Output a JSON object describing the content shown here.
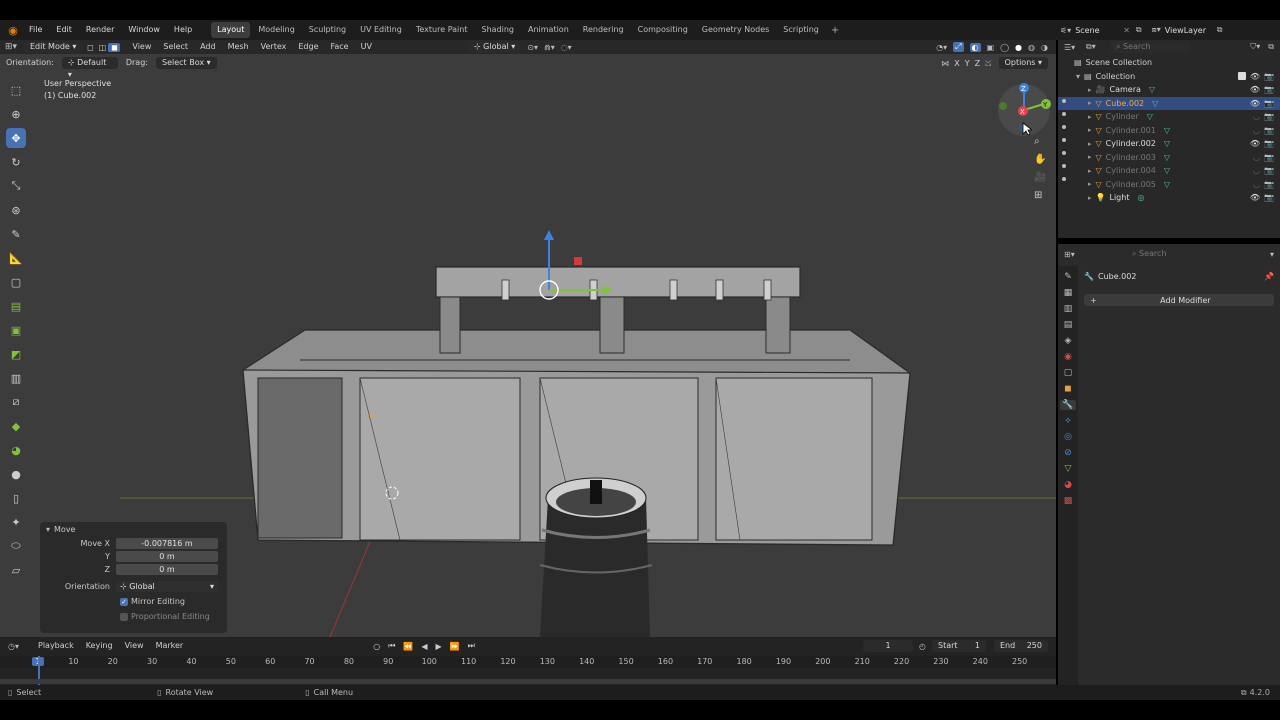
{
  "menu": [
    "File",
    "Edit",
    "Render",
    "Window",
    "Help"
  ],
  "workspaces": [
    "Layout",
    "Modeling",
    "Sculpting",
    "UV Editing",
    "Texture Paint",
    "Shading",
    "Animation",
    "Rendering",
    "Compositing",
    "Geometry Nodes",
    "Scripting"
  ],
  "active_workspace": "Layout",
  "scene": "Scene",
  "view_layer": "ViewLayer",
  "viewport": {
    "mode": "Edit Mode",
    "menus": [
      "View",
      "Select",
      "Add",
      "Mesh",
      "Vertex",
      "Edge",
      "Face",
      "UV"
    ],
    "transform_orientation": "Global",
    "orientation_label": "Orientation:",
    "orientation_value": "Default",
    "drag_label": "Drag:",
    "drag_value": "Select Box",
    "options": "Options",
    "axis_x": "X",
    "axis_y": "Y",
    "axis_z": "Z",
    "view_name": "User Perspective",
    "object_name": "(1) Cube.002"
  },
  "move_panel": {
    "title": "Move",
    "move_x_label": "Move X",
    "move_x": "-0.007816 m",
    "y_label": "Y",
    "y": "0 m",
    "z_label": "Z",
    "z": "0 m",
    "orientation_label": "Orientation",
    "orientation": "Global",
    "mirror_editing": "Mirror Editing",
    "proportional_editing": "Proportional Editing"
  },
  "timeline": {
    "menus": [
      "Playback",
      "Keying",
      "View",
      "Marker"
    ],
    "current_frame": "1",
    "start_label": "Start",
    "start": "1",
    "end_label": "End",
    "end": "250",
    "ticks": [
      "1",
      "10",
      "20",
      "30",
      "40",
      "50",
      "60",
      "70",
      "80",
      "90",
      "100",
      "110",
      "120",
      "130",
      "140",
      "150",
      "160",
      "170",
      "180",
      "190",
      "200",
      "210",
      "220",
      "230",
      "240",
      "250"
    ]
  },
  "outliner": {
    "search_placeholder": "Search",
    "scene_collection": "Scene Collection",
    "collection": "Collection",
    "items": [
      {
        "name": "Camera",
        "selected": false,
        "visible": true
      },
      {
        "name": "Cube.002",
        "selected": true,
        "visible": true
      },
      {
        "name": "Cylinder",
        "selected": false,
        "visible": false
      },
      {
        "name": "Cylinder.001",
        "selected": false,
        "visible": false
      },
      {
        "name": "Cylinder.002",
        "selected": false,
        "visible": true
      },
      {
        "name": "Cylinder.003",
        "selected": false,
        "visible": false
      },
      {
        "name": "Cylinder.004",
        "selected": false,
        "visible": false
      },
      {
        "name": "Cylinder.005",
        "selected": false,
        "visible": false
      },
      {
        "name": "Light",
        "selected": false,
        "visible": true
      }
    ]
  },
  "properties": {
    "search_placeholder": "Search",
    "object": "Cube.002",
    "add_modifier": "Add Modifier"
  },
  "status": {
    "select": "Select",
    "rotate_view": "Rotate View",
    "call_menu": "Call Menu",
    "version": "4.2.0"
  },
  "colors": {
    "accent": "#4772b3",
    "selection": "#334d80",
    "x_axis": "#e2424a",
    "y_axis": "#7fc33a",
    "z_axis": "#3b83e0"
  }
}
